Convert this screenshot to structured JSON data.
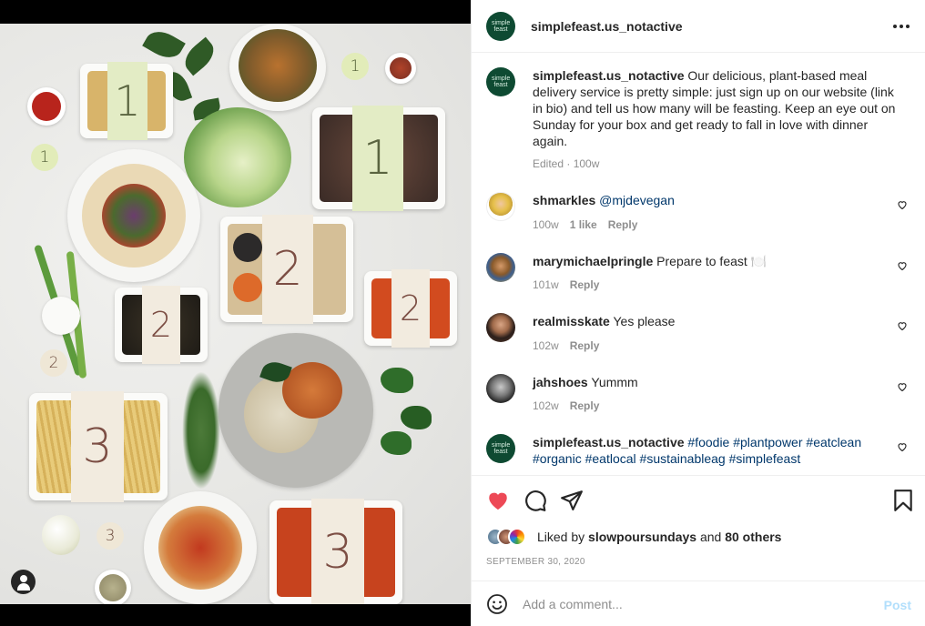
{
  "post": {
    "username": "simplefeast.us_notactive",
    "brand_avatar_text": "simple feast"
  },
  "photo": {
    "tray_numbers": [
      "1",
      "1",
      "2",
      "2",
      "2",
      "3",
      "3"
    ],
    "chip_numbers": [
      "1",
      "1",
      "2",
      "3"
    ]
  },
  "caption": {
    "username": "simplefeast.us_notactive",
    "text": "Our delicious, plant-based meal delivery service is pretty simple: just sign up on our website (link in bio) and tell us how many will be feasting. Keep an eye out on Sunday for your box and get ready to fall in love with dinner again.",
    "meta": "Edited · 100w"
  },
  "comments": [
    {
      "username": "shmarkles",
      "mention": "@mjdevegan",
      "text": "",
      "age": "100w",
      "likes": "1 like",
      "reply": "Reply"
    },
    {
      "username": "marymichaelpringle",
      "mention": "",
      "text": "Prepare to feast 🍽️",
      "age": "101w",
      "likes": "",
      "reply": "Reply"
    },
    {
      "username": "realmisskate",
      "mention": "",
      "text": "Yes please",
      "age": "102w",
      "likes": "",
      "reply": "Reply"
    },
    {
      "username": "jahshoes",
      "mention": "",
      "text": "Yummm",
      "age": "102w",
      "likes": "",
      "reply": "Reply"
    }
  ],
  "hashtag_comment": {
    "username": "simplefeast.us_notactive",
    "tags": [
      "#foodie",
      "#plantpower",
      "#eatclean",
      "#organic",
      "#eatlocal",
      "#sustainableag",
      "#simplefeast"
    ]
  },
  "likes": {
    "prefix": "Liked by",
    "user": "slowpoursundays",
    "and": "and",
    "others": "80 others"
  },
  "date": "SEPTEMBER 30, 2020",
  "add_comment": {
    "placeholder": "Add a comment...",
    "post_label": "Post"
  },
  "colors": {
    "like_red": "#ed4956",
    "link_blue": "#00376b",
    "muted": "#8e8e8e",
    "brand_green": "#0e4a32",
    "post_disabled": "#b2dffc"
  }
}
